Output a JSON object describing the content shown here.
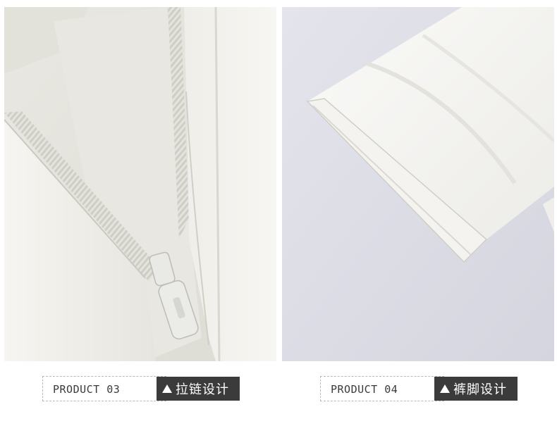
{
  "panels": [
    {
      "id": "left",
      "photo_icon": "zipper-closeup-photo",
      "product_code": "PRODUCT 03",
      "feature_icon": "triangle-up-icon",
      "feature_label": "拉链设计"
    },
    {
      "id": "right",
      "photo_icon": "trouser-hem-closeup-photo",
      "product_code": "PRODUCT 04",
      "feature_icon": "triangle-up-icon",
      "feature_label": "裤脚设计"
    }
  ],
  "colors": {
    "fabric": "#f2f1ec",
    "backdrop_right": "#dcdce6",
    "tag_background": "#3b3b3b",
    "tag_text": "#ffffff",
    "code_text": "#3a3a3a"
  }
}
